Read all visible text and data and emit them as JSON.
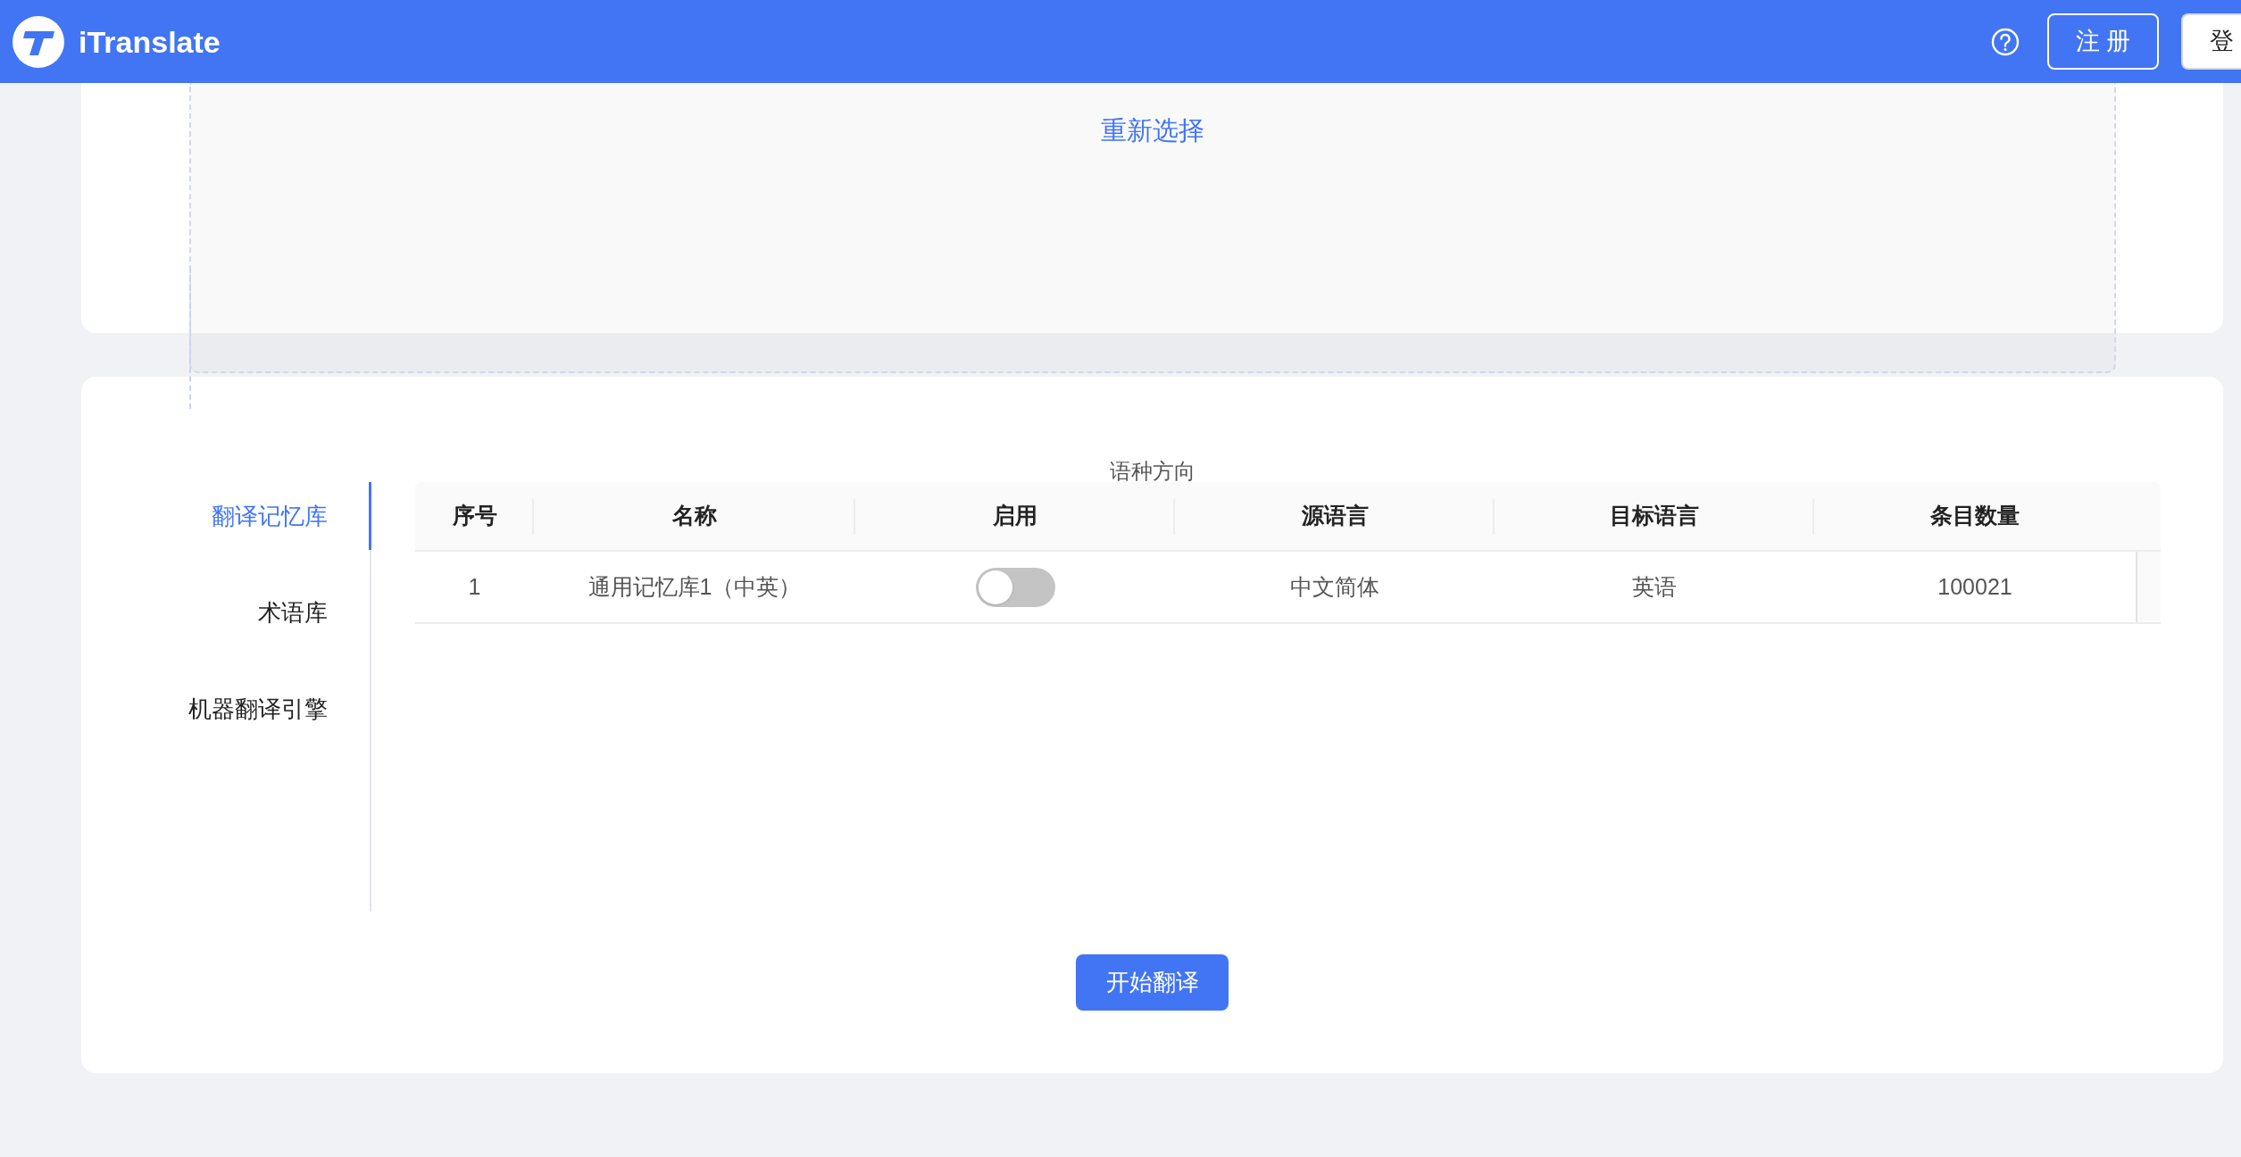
{
  "header": {
    "app_name": "iTranslate",
    "buttons": [
      {
        "label": "注 册",
        "kind": "outline"
      },
      {
        "label": "登",
        "kind": "solid"
      }
    ]
  },
  "upload": {
    "action": "重新选择"
  },
  "settings": {
    "caption": "语种方向",
    "tabs": [
      {
        "label": "翻译记忆库",
        "selected": true
      },
      {
        "label": "术语库",
        "selected": false
      },
      {
        "label": "机器翻译引擎",
        "selected": false
      }
    ],
    "table": {
      "columns": [
        "序号",
        "名称",
        "启用",
        "源语言",
        "目标语言",
        "条目数量"
      ],
      "rows": [
        {
          "index": "1",
          "name": "通用记忆库1（中英）",
          "enabled": false,
          "source": "中文简体",
          "target": "英语",
          "count": "100021"
        }
      ]
    }
  },
  "start_button": "开始翻译"
}
